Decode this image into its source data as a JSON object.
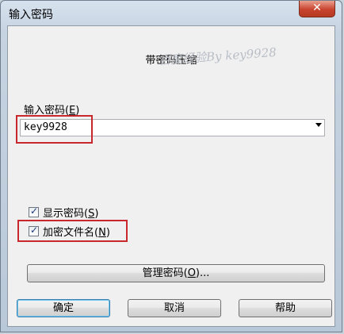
{
  "window": {
    "title": "输入密码",
    "close_label": "✕"
  },
  "profile": {
    "name": "带密码压缩"
  },
  "watermark": "百度经验By key9928",
  "password": {
    "label_prefix": "输入密码(",
    "label_key": "E",
    "label_suffix": ")",
    "value": "key9928"
  },
  "options": {
    "show_password": {
      "prefix": "显示密码(",
      "key": "S",
      "suffix": ")",
      "checked": true
    },
    "encrypt_filenames": {
      "prefix": "加密文件名(",
      "key": "N",
      "suffix": ")",
      "checked": true
    }
  },
  "buttons": {
    "manage_prefix": "管理密码(",
    "manage_key": "O",
    "manage_suffix": ")...",
    "ok": "确定",
    "cancel": "取消",
    "help": "帮助"
  },
  "colors": {
    "highlight_box": "#c8282d",
    "close_button": "#c8432d"
  }
}
